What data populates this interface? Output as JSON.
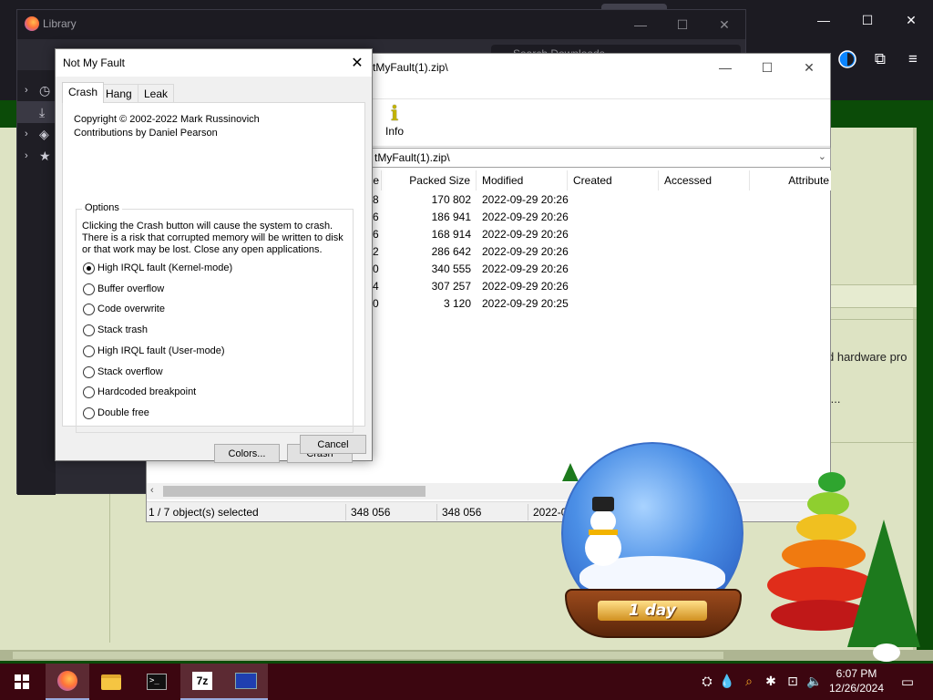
{
  "firefox": {
    "library_title": "Library",
    "library_search_placeholder": "Search Downloads",
    "library_sidebar": [
      {
        "icon": "history-icon",
        "glyph": "◷"
      },
      {
        "icon": "download-icon",
        "glyph": "⤓"
      },
      {
        "icon": "tags-icon",
        "glyph": "◈"
      },
      {
        "icon": "star-icon",
        "glyph": "★"
      }
    ],
    "window_controls": {
      "minimize": "—",
      "maximize": "☐",
      "close": "✕"
    },
    "toolbar_icons": [
      "profile-icon",
      "extensions-icon",
      "menu-icon"
    ],
    "page_text": {
      "line1": "d hardware pro",
      "line2": "...."
    }
  },
  "sevenzip": {
    "title": "tMyFault(1).zip\\",
    "toolbar": {
      "info_label": "Info"
    },
    "path": "tMyFault(1).zip\\",
    "columns": [
      "e",
      "Packed Size",
      "Modified",
      "Created",
      "Accessed",
      "Attribute"
    ],
    "rows": [
      {
        "size_tail": "8",
        "packed": "170 802",
        "modified": "2022-09-29 20:26"
      },
      {
        "size_tail": "6",
        "packed": "186 941",
        "modified": "2022-09-29 20:26"
      },
      {
        "size_tail": "6",
        "packed": "168 914",
        "modified": "2022-09-29 20:26"
      },
      {
        "size_tail": "2",
        "packed": "286 642",
        "modified": "2022-09-29 20:26"
      },
      {
        "size_tail": "0",
        "packed": "340 555",
        "modified": "2022-09-29 20:26"
      },
      {
        "size_tail": "4",
        "packed": "307 257",
        "modified": "2022-09-29 20:26"
      },
      {
        "size_tail": "0",
        "packed": "3 120",
        "modified": "2022-09-29 20:25"
      }
    ],
    "status": {
      "selected": "1 / 7 object(s) selected",
      "size": "348 056",
      "packed": "348 056",
      "modified": "2022-0"
    }
  },
  "nmf": {
    "title": "Not My Fault",
    "tabs": [
      "Crash",
      "Hang",
      "Leak"
    ],
    "copyright": "Copyright © 2002-2022 Mark Russinovich",
    "contributions": "Contributions by Daniel Pearson",
    "options_label": "Options",
    "warning": [
      "Clicking the Crash button will cause the system to crash.",
      "There is a risk that corrupted memory will be written to disk",
      "or that work may be lost. Close any open applications."
    ],
    "options": [
      {
        "label": "High IRQL fault (Kernel-mode)",
        "selected": true
      },
      {
        "label": "Buffer overflow",
        "selected": false
      },
      {
        "label": "Code overwrite",
        "selected": false
      },
      {
        "label": "Stack trash",
        "selected": false
      },
      {
        "label": "High IRQL fault (User-mode)",
        "selected": false
      },
      {
        "label": "Stack overflow",
        "selected": false
      },
      {
        "label": "Hardcoded breakpoint",
        "selected": false
      },
      {
        "label": "Double free",
        "selected": false
      }
    ],
    "colors_button": "Colors...",
    "crash_button": "Crash",
    "cancel_button": "Cancel"
  },
  "decoration": {
    "plaque": "1 day"
  },
  "taskbar": {
    "apps": [
      "firefox-icon",
      "file-explorer-icon",
      "terminal-icon",
      "7zip-icon",
      "notmyfault-icon"
    ],
    "sevenzip_label": "7z",
    "time": "6:07 PM",
    "date": "12/26/2024"
  }
}
